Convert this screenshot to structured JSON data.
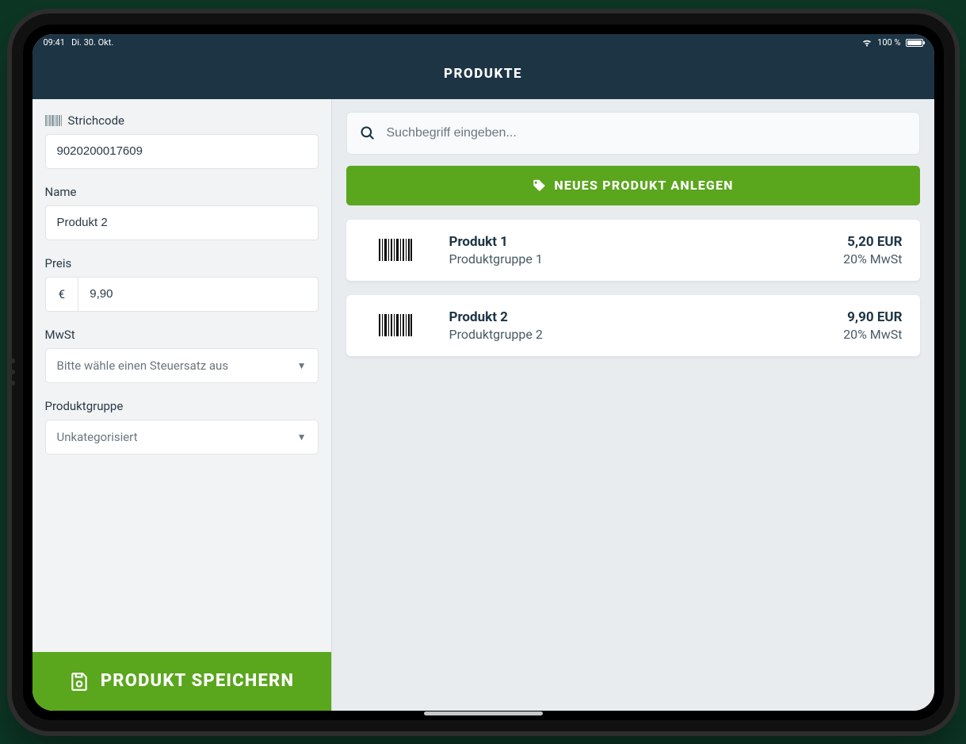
{
  "status": {
    "time": "09:41",
    "date": "Di. 30. Okt.",
    "battery": "100 %"
  },
  "header": {
    "title": "PRODUKTE"
  },
  "form": {
    "barcode_label": "Strichcode",
    "barcode_value": "9020200017609",
    "name_label": "Name",
    "name_value": "Produkt 2",
    "price_label": "Preis",
    "currency": "€",
    "price_value": "9,90",
    "vat_label": "MwSt",
    "vat_placeholder": "Bitte wähle einen Steuersatz aus",
    "group_label": "Produktgruppe",
    "group_value": "Unkategorisiert",
    "save_button": "PRODUKT SPEICHERN"
  },
  "search": {
    "placeholder": "Suchbegriff eingeben..."
  },
  "new_product_button": "NEUES PRODUKT ANLEGEN",
  "products": [
    {
      "name": "Produkt 1",
      "group": "Produktgruppe 1",
      "price": "5,20 EUR",
      "tax": "20% MwSt"
    },
    {
      "name": "Produkt 2",
      "group": "Produktgruppe 2",
      "price": "9,90 EUR",
      "tax": "20% MwSt"
    }
  ]
}
